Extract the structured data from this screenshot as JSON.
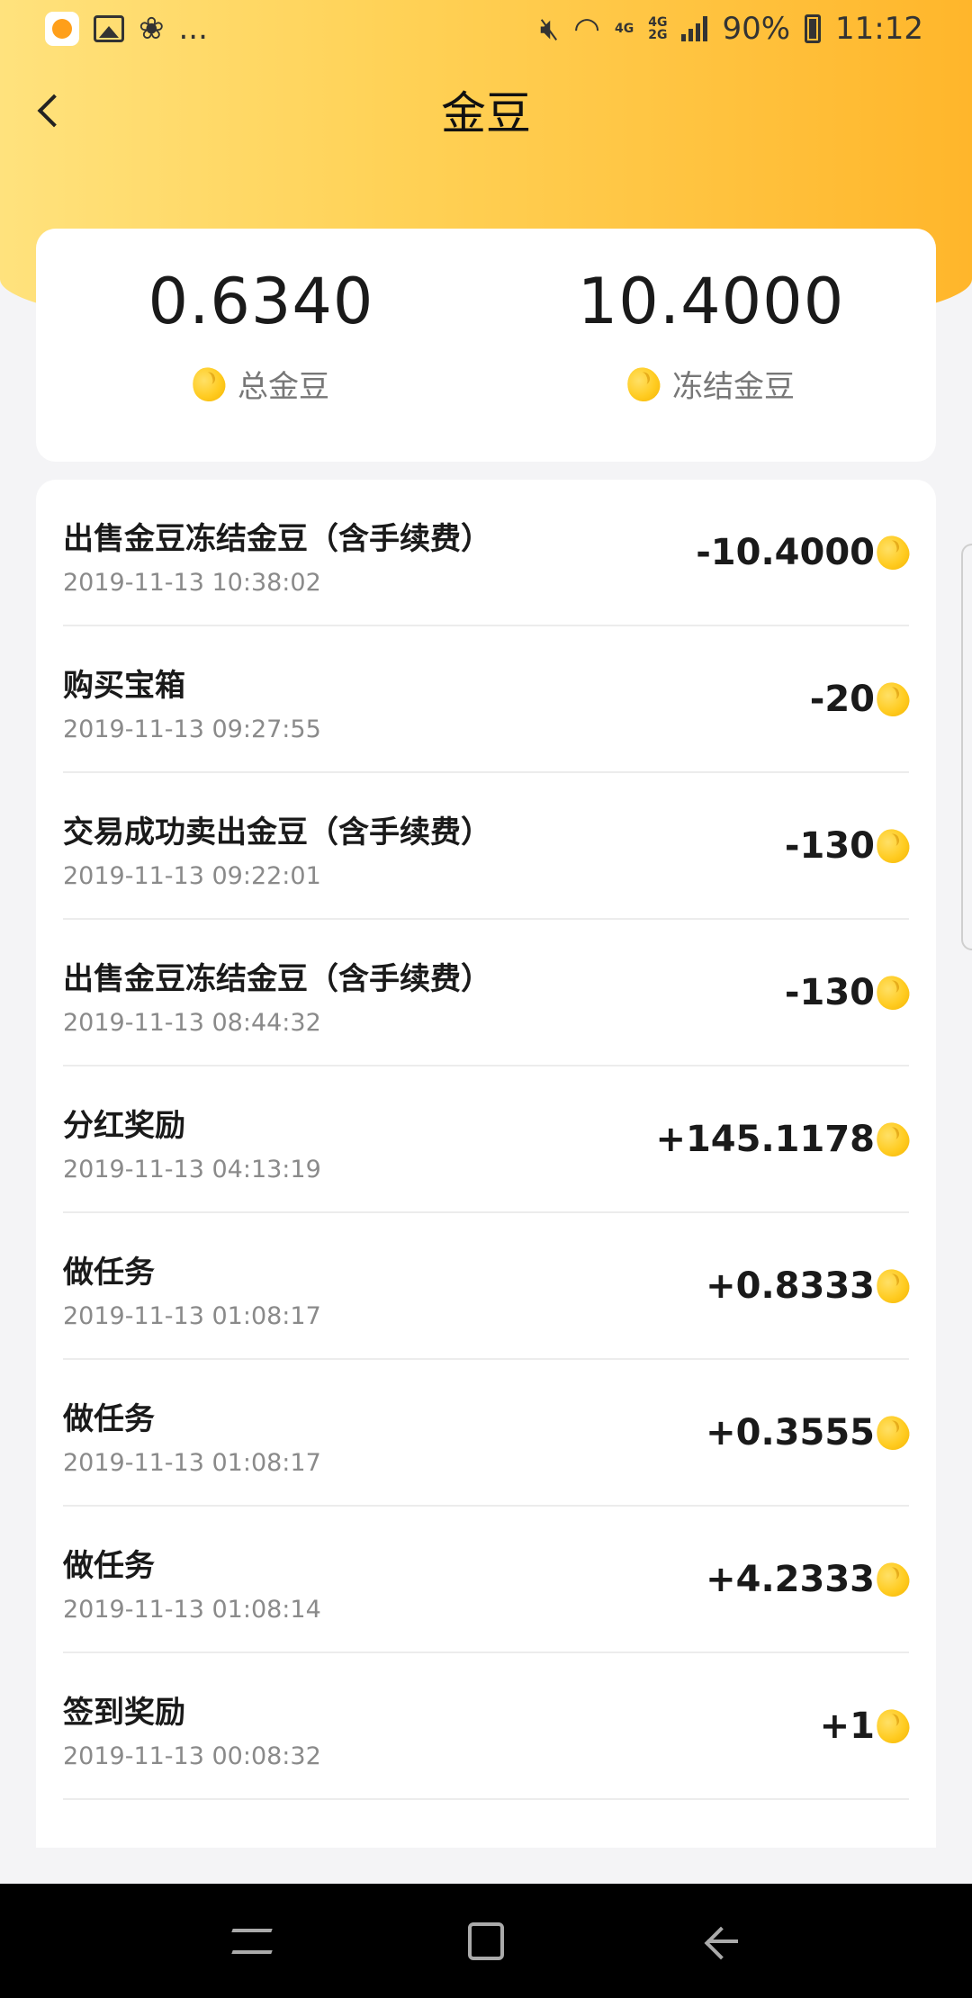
{
  "status_bar": {
    "more": "...",
    "net_top": "4G",
    "net_dual_top": "4G",
    "net_dual_bottom": "2G",
    "battery": "90%",
    "time": "11:12"
  },
  "header": {
    "title": "金豆"
  },
  "summary": {
    "total_value": "0.6340",
    "total_label": "总金豆",
    "frozen_value": "10.4000",
    "frozen_label": "冻结金豆"
  },
  "transactions": [
    {
      "title": "出售金豆冻结金豆（含手续费）",
      "date": "2019-11-13 10:38:02",
      "amount": "-10.4000"
    },
    {
      "title": "购买宝箱",
      "date": "2019-11-13 09:27:55",
      "amount": "-20"
    },
    {
      "title": "交易成功卖出金豆（含手续费）",
      "date": "2019-11-13 09:22:01",
      "amount": "-130"
    },
    {
      "title": "出售金豆冻结金豆（含手续费）",
      "date": "2019-11-13 08:44:32",
      "amount": "-130"
    },
    {
      "title": "分红奖励",
      "date": "2019-11-13 04:13:19",
      "amount": "+145.1178"
    },
    {
      "title": "做任务",
      "date": "2019-11-13 01:08:17",
      "amount": "+0.8333"
    },
    {
      "title": "做任务",
      "date": "2019-11-13 01:08:17",
      "amount": "+0.3555"
    },
    {
      "title": "做任务",
      "date": "2019-11-13 01:08:14",
      "amount": "+4.2333"
    },
    {
      "title": "签到奖励",
      "date": "2019-11-13 00:08:32",
      "amount": "+1"
    }
  ],
  "icons": {
    "bean": "gold-bean-icon",
    "back": "chevron-left-icon"
  },
  "colors": {
    "header_gradient_start": "#ffe27d",
    "header_gradient_end": "#ffb62b",
    "bean": "#ffcc22"
  }
}
